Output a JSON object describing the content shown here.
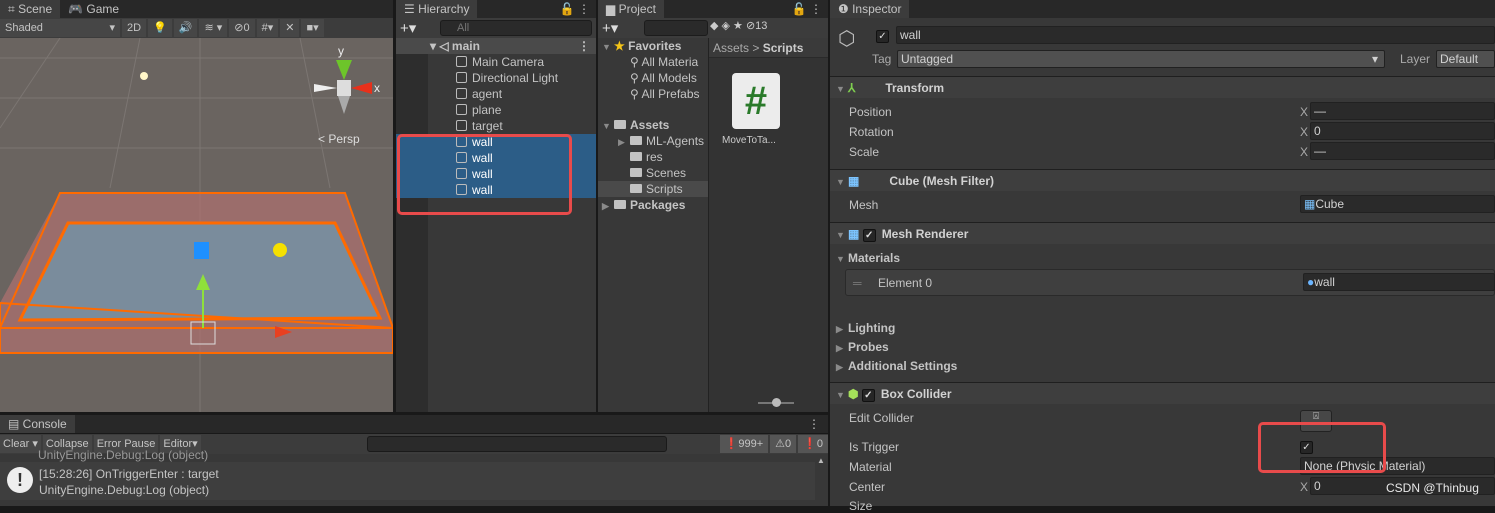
{
  "scene": {
    "tabs": [
      "Scene",
      "Game"
    ],
    "shading": "Shaded",
    "mode_2d": "2D",
    "hidden_count": "0",
    "projection": "Persp",
    "axis_y": "y",
    "axis_x": "x"
  },
  "hierarchy": {
    "title": "Hierarchy",
    "search_placeholder": "All",
    "scene_name": "main",
    "items": [
      {
        "label": "Main Camera",
        "selected": false
      },
      {
        "label": "Directional Light",
        "selected": false
      },
      {
        "label": "agent",
        "selected": false
      },
      {
        "label": "plane",
        "selected": false
      },
      {
        "label": "target",
        "selected": false
      },
      {
        "label": "wall",
        "selected": true
      },
      {
        "label": "wall",
        "selected": true
      },
      {
        "label": "wall",
        "selected": true
      },
      {
        "label": "wall",
        "selected": true
      }
    ]
  },
  "project": {
    "title": "Project",
    "hidden_count": "13",
    "favorites": {
      "label": "Favorites",
      "items": [
        "All Materia",
        "All Models",
        "All Prefabs"
      ]
    },
    "assets": {
      "label": "Assets",
      "items": [
        "ML-Agents",
        "res",
        "Scenes",
        "Scripts"
      ]
    },
    "packages": "Packages",
    "breadcrumb": [
      "Assets",
      "Scripts"
    ],
    "files": [
      {
        "name": "MoveToTa...",
        "icon": "csharp-script-icon"
      }
    ]
  },
  "inspector": {
    "title": "Inspector",
    "object_name": "wall",
    "active": true,
    "tag_label": "Tag",
    "tag": "Untagged",
    "layer_label": "Layer",
    "layer": "Default",
    "transform": {
      "title": "Transform",
      "rows": [
        {
          "label": "Position",
          "axis": "X",
          "value": "—"
        },
        {
          "label": "Rotation",
          "axis": "X",
          "value": "0"
        },
        {
          "label": "Scale",
          "axis": "X",
          "value": "—"
        }
      ]
    },
    "mesh_filter": {
      "title": "Cube (Mesh Filter)",
      "mesh_label": "Mesh",
      "mesh": "Cube"
    },
    "mesh_renderer": {
      "title": "Mesh Renderer",
      "materials_label": "Materials",
      "element_label": "Element 0",
      "element_value": "wall",
      "sections": [
        "Lighting",
        "Probes",
        "Additional Settings"
      ]
    },
    "box_collider": {
      "title": "Box Collider",
      "edit_label": "Edit Collider",
      "trigger_label": "Is Trigger",
      "is_trigger": true,
      "material_label": "Material",
      "material": "None (Physic Material)",
      "center_label": "Center",
      "center_axis": "X",
      "center_x": "0",
      "size_label": "Size"
    }
  },
  "console": {
    "title": "Console",
    "buttons": [
      "Clear",
      "Collapse",
      "Error Pause",
      "Editor"
    ],
    "log_count": "999+",
    "warn_count": "0",
    "error_count": "0",
    "partial_line": "UnityEngine.Debug:Log (object)",
    "entries": [
      {
        "line1": "[15:28:26] OnTriggerEnter : target",
        "line2": "UnityEngine.Debug:Log (object)"
      }
    ]
  },
  "watermark": "CSDN @Thinbug",
  "colors": {
    "selection": "#2c5d87",
    "highlight_box": "#e84b4b",
    "wall_outline": "#ff6a00"
  }
}
